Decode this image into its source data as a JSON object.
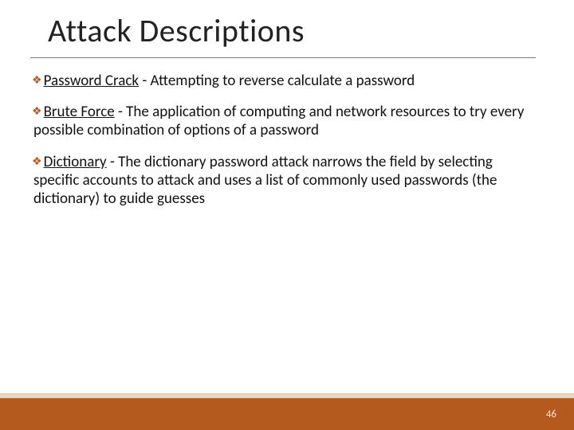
{
  "title": "Attack Descriptions",
  "items": [
    {
      "term": "Password Crack",
      "desc": " - Attempting to reverse calculate a password"
    },
    {
      "term": "Brute Force",
      "desc": " - The application of computing and network resources to try every possible combination of options of a password"
    },
    {
      "term": "Dictionary",
      "desc": " - The dictionary password attack narrows the field by selecting specific accounts to attack and uses a list of commonly used passwords (the dictionary) to guide guesses"
    }
  ],
  "slide_number": "46"
}
